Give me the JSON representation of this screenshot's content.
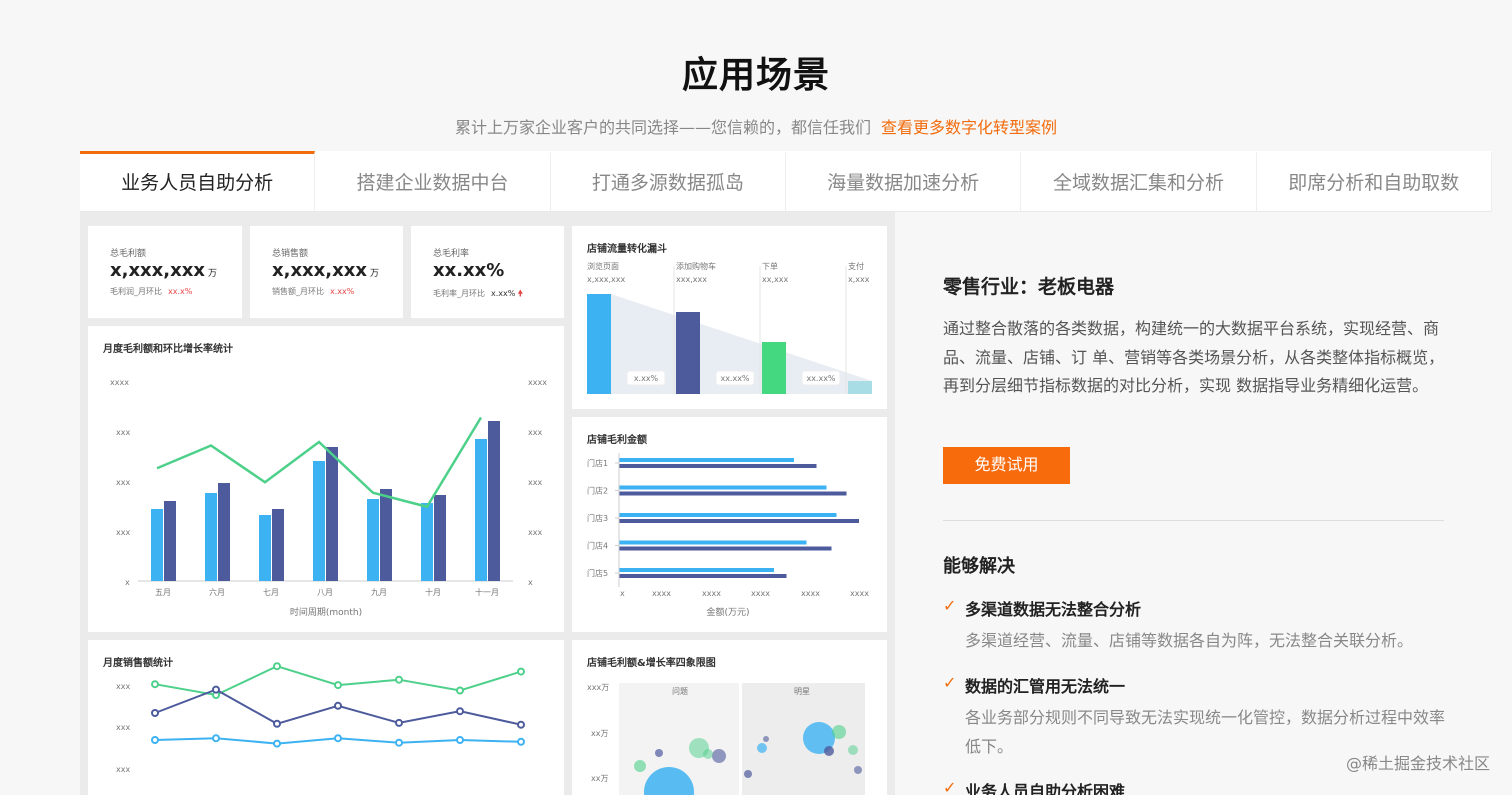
{
  "header": {
    "title": "应用场景",
    "subtitle": "累计上万家企业客户的共同选择——您信赖的，都信任我们",
    "link": "查看更多数字化转型案例"
  },
  "tabs": [
    {
      "label": "业务人员自助分析",
      "active": true
    },
    {
      "label": "搭建企业数据中台",
      "active": false
    },
    {
      "label": "打通多源数据孤岛",
      "active": false
    },
    {
      "label": "海量数据加速分析",
      "active": false
    },
    {
      "label": "全域数据汇集和分析",
      "active": false
    },
    {
      "label": "即席分析和自助取数",
      "active": false
    }
  ],
  "dashboard": {
    "kpis": [
      {
        "label": "总毛利额",
        "value": "x,xxx,xxx",
        "unit": "万",
        "sub": "毛利润_月环比",
        "delta": "xx.x%"
      },
      {
        "label": "总销售额",
        "value": "x,xxx,xxx",
        "unit": "万",
        "sub": "销售额_月环比",
        "delta": "x.xx%"
      },
      {
        "label": "总毛利率",
        "value": "xx.xx%",
        "unit": "",
        "sub": "毛利率_月环比",
        "delta": "x.xx%"
      }
    ],
    "monthly_title": "月度毛利额和环比增长率统计",
    "monthly_xlabel": "时间周期(month)",
    "monthly_yticks_left": [
      "xxxx",
      "xxx",
      "xxx",
      "xxx",
      "x"
    ],
    "monthly_yticks_right": [
      "xxxx",
      "xxx",
      "xxx",
      "xxx",
      "x"
    ],
    "funnel_title": "店铺流量转化漏斗",
    "funnel_stages": [
      {
        "label": "浏览页面",
        "value": "x,xxx,xxx"
      },
      {
        "label": "添加购物车",
        "value": "xxx,xxx"
      },
      {
        "label": "下单",
        "value": "xx,xxx"
      },
      {
        "label": "支付",
        "value": "x,xxx"
      }
    ],
    "funnel_rates": [
      "x.xx%",
      "xx.xx%",
      "xx.xx%"
    ],
    "store_title": "店铺毛利金额",
    "store_xlabel": "金额(万元)",
    "store_xticks": [
      "x",
      "xxxx",
      "xxxx",
      "xxxx",
      "xxxx",
      "xxxx"
    ],
    "sales_title": "月度销售额统计",
    "sales_yticks": [
      "xxx",
      "xxx",
      "xxx"
    ],
    "quad_title": "店铺毛利额&增长率四象限图",
    "quad_yticks": [
      "xxx万",
      "xx万",
      "xx万"
    ],
    "quad_labels": [
      "问题",
      "明星"
    ]
  },
  "chart_data": [
    {
      "type": "bar",
      "title": "月度毛利额和环比增长率统计",
      "xlabel": "时间周期(month)",
      "categories": [
        "五月",
        "六月",
        "七月",
        "八月",
        "九月",
        "十月",
        "十一月"
      ],
      "series": [
        {
          "values": [
            36,
            44,
            33,
            60,
            41,
            39,
            71
          ]
        },
        {
          "values": [
            40,
            49,
            36,
            67,
            46,
            43,
            80
          ]
        },
        {
          "values": [
            73,
            86,
            65,
            88,
            59,
            51,
            102
          ]
        }
      ],
      "colors": [
        "#3cb2f2",
        "#4d5a9c",
        "#4cd08a"
      ]
    },
    {
      "type": "bar",
      "title": "店铺毛利金额",
      "xlabel": "金额(万元)",
      "categories": [
        "门店1",
        "门店2",
        "门店3",
        "门店4",
        "门店5"
      ],
      "series": [
        {
          "values": [
            70,
            83,
            87,
            75,
            62
          ]
        },
        {
          "values": [
            79,
            91,
            96,
            85,
            67
          ]
        }
      ],
      "colors": [
        "#3cb2f2",
        "#4d5a9c"
      ]
    },
    {
      "type": "bar",
      "title": "店铺流量转化漏斗",
      "categories": [
        "浏览页面",
        "添加购物车",
        "下单",
        "支付"
      ],
      "values": [
        100,
        82,
        52,
        13
      ],
      "colors": [
        "#3cb2f2",
        "#4d5a9c",
        "#44d981",
        "#a9dde6"
      ]
    },
    {
      "type": "line",
      "title": "月度销售额统计",
      "series": [
        {
          "values": [
            42,
            30,
            62,
            41,
            47,
            35,
            56
          ]
        },
        {
          "values": [
            10,
            36,
            -2,
            18,
            -1,
            12,
            -3
          ]
        },
        {
          "values": [
            -20,
            -18,
            -24,
            -18,
            -23,
            -20,
            -22
          ]
        }
      ],
      "colors": [
        "#4cd08a",
        "#4d5a9c",
        "#3cb2f2"
      ]
    },
    {
      "type": "scatter",
      "title": "店铺毛利额&增长率四象限图",
      "quadrants": [
        "问题",
        "明星"
      ]
    }
  ],
  "case": {
    "title": "零售行业：老板电器",
    "desc": "通过整合散落的各类数据，构建统一的大数据平台系统，实现经营、商品、流量、店铺、订 单、营销等各类场景分析，从各类整体指标概览，再到分层细节指标数据的对比分析，实现 数据指导业务精细化运营。",
    "button": "免费试用",
    "solve_title": "能够解决",
    "items": [
      {
        "title": "多渠道数据无法整合分析",
        "desc": "多渠道经营、流量、店铺等数据各自为阵，无法整合关联分析。"
      },
      {
        "title": "数据的汇管用无法统一",
        "desc": "各业务部分规则不同导致无法实现统一化管控，数据分析过程中效率低下。"
      },
      {
        "title": "业务人员自助分析困难",
        "desc": ""
      }
    ]
  },
  "watermark": "@稀土掘金技术社区",
  "colors": {
    "accent": "#f26c0d",
    "bar_blue": "#3cb2f2",
    "bar_navy": "#4d5a9c",
    "line_green": "#4cd08a"
  }
}
